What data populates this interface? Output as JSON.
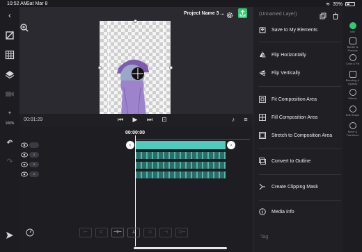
{
  "status_bar": {
    "time": "10:52 AM",
    "date": "Sat Mar 8",
    "battery": "35%"
  },
  "project": {
    "title": "Project Name 3 ..."
  },
  "canvas": {
    "zoom_label": "100%"
  },
  "playback": {
    "current_time": "00:01:29"
  },
  "timeline": {
    "timecode": "00:00:00",
    "layers": [
      {
        "label": ""
      },
      {
        "label": "4"
      },
      {
        "label": "3"
      },
      {
        "label": "2"
      }
    ]
  },
  "panel": {
    "header": "(Unnamed Layer)",
    "menu": [
      {
        "label": "Save to My Elements",
        "icon": "save-element-icon"
      },
      {
        "label": "Flip Horizontally",
        "icon": "flip-horizontal-icon"
      },
      {
        "label": "Flip Vertically",
        "icon": "flip-vertical-icon"
      },
      {
        "label": "Fit Composition Area",
        "icon": "fit-area-icon"
      },
      {
        "label": "Fill Composition Area",
        "icon": "fill-area-icon"
      },
      {
        "label": "Stretch to Composition Area",
        "icon": "stretch-area-icon"
      },
      {
        "label": "Convert to Outline",
        "icon": "outline-icon"
      },
      {
        "label": "Create Clipping Mask",
        "icon": "clipping-mask-icon"
      },
      {
        "label": "Media Info",
        "icon": "info-icon"
      }
    ],
    "tag_placeholder": "Tag"
  },
  "right_sidebar": [
    {
      "label": "Info",
      "icon": "info-dot-icon",
      "active": true
    },
    {
      "label": "Border & Shadow",
      "icon": "border-shadow-icon"
    },
    {
      "label": "Color & Fill",
      "icon": "color-fill-icon"
    },
    {
      "label": "Blending & Opacity",
      "icon": "blending-icon"
    },
    {
      "label": "Effects",
      "icon": "effects-icon"
    },
    {
      "label": "Edit Shape",
      "icon": "edit-shape-icon"
    },
    {
      "label": "Move & Transform",
      "icon": "move-transform-icon"
    }
  ],
  "colors": {
    "accent": "#2ecc71",
    "clip": "#51c9bd",
    "panel_bg": "#1f1f24"
  }
}
